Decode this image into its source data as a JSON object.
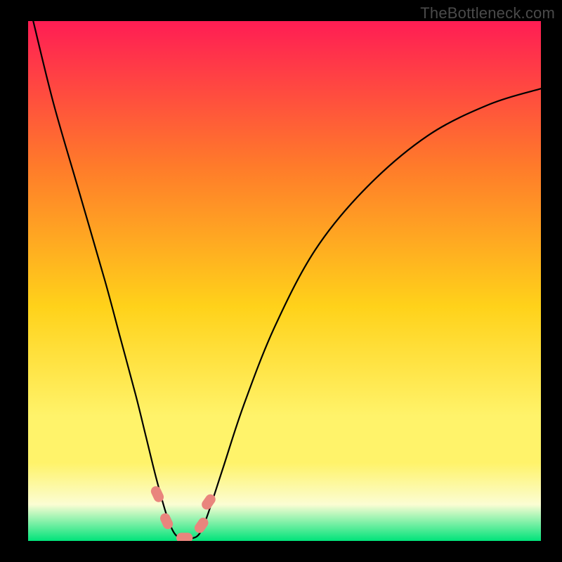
{
  "watermark": "TheBottleneck.com",
  "chart_data": {
    "type": "line",
    "title": "",
    "xlabel": "",
    "ylabel": "",
    "xlim": [
      0,
      100
    ],
    "ylim": [
      0,
      100
    ],
    "legend": null,
    "grid": false,
    "background_gradient": {
      "top_color": "#ff1d54",
      "upper_mid_color": "#ff7b2a",
      "mid_color": "#ffd21a",
      "lower_mid_color": "#fff36a",
      "pale_band_color": "#fbfdd3",
      "bottom_color": "#00e37a"
    },
    "series": [
      {
        "name": "bottleneck-curve",
        "color": "#000000",
        "x": [
          1,
          5,
          10,
          15,
          18,
          21,
          23,
          25,
          27,
          28.5,
          30,
          32,
          33.5,
          35,
          38,
          42,
          48,
          56,
          66,
          78,
          90,
          100
        ],
        "y": [
          100,
          84,
          67,
          50,
          39,
          28,
          20,
          12,
          5,
          1.5,
          0.5,
          0.5,
          1.5,
          5,
          14,
          26,
          41,
          56,
          68,
          78,
          84,
          87
        ]
      }
    ],
    "markers": [
      {
        "name": "marker-left-upper",
        "x": 25.2,
        "y": 9.0,
        "color": "#e9857d",
        "size": 9
      },
      {
        "name": "marker-left-lower",
        "x": 27.0,
        "y": 3.8,
        "color": "#e9857d",
        "size": 9
      },
      {
        "name": "marker-minimum",
        "x": 30.5,
        "y": 0.6,
        "color": "#e9857d",
        "size": 9
      },
      {
        "name": "marker-right-lower",
        "x": 33.8,
        "y": 3.0,
        "color": "#e9857d",
        "size": 9
      },
      {
        "name": "marker-right-upper",
        "x": 35.2,
        "y": 7.5,
        "color": "#e9857d",
        "size": 9
      }
    ]
  }
}
